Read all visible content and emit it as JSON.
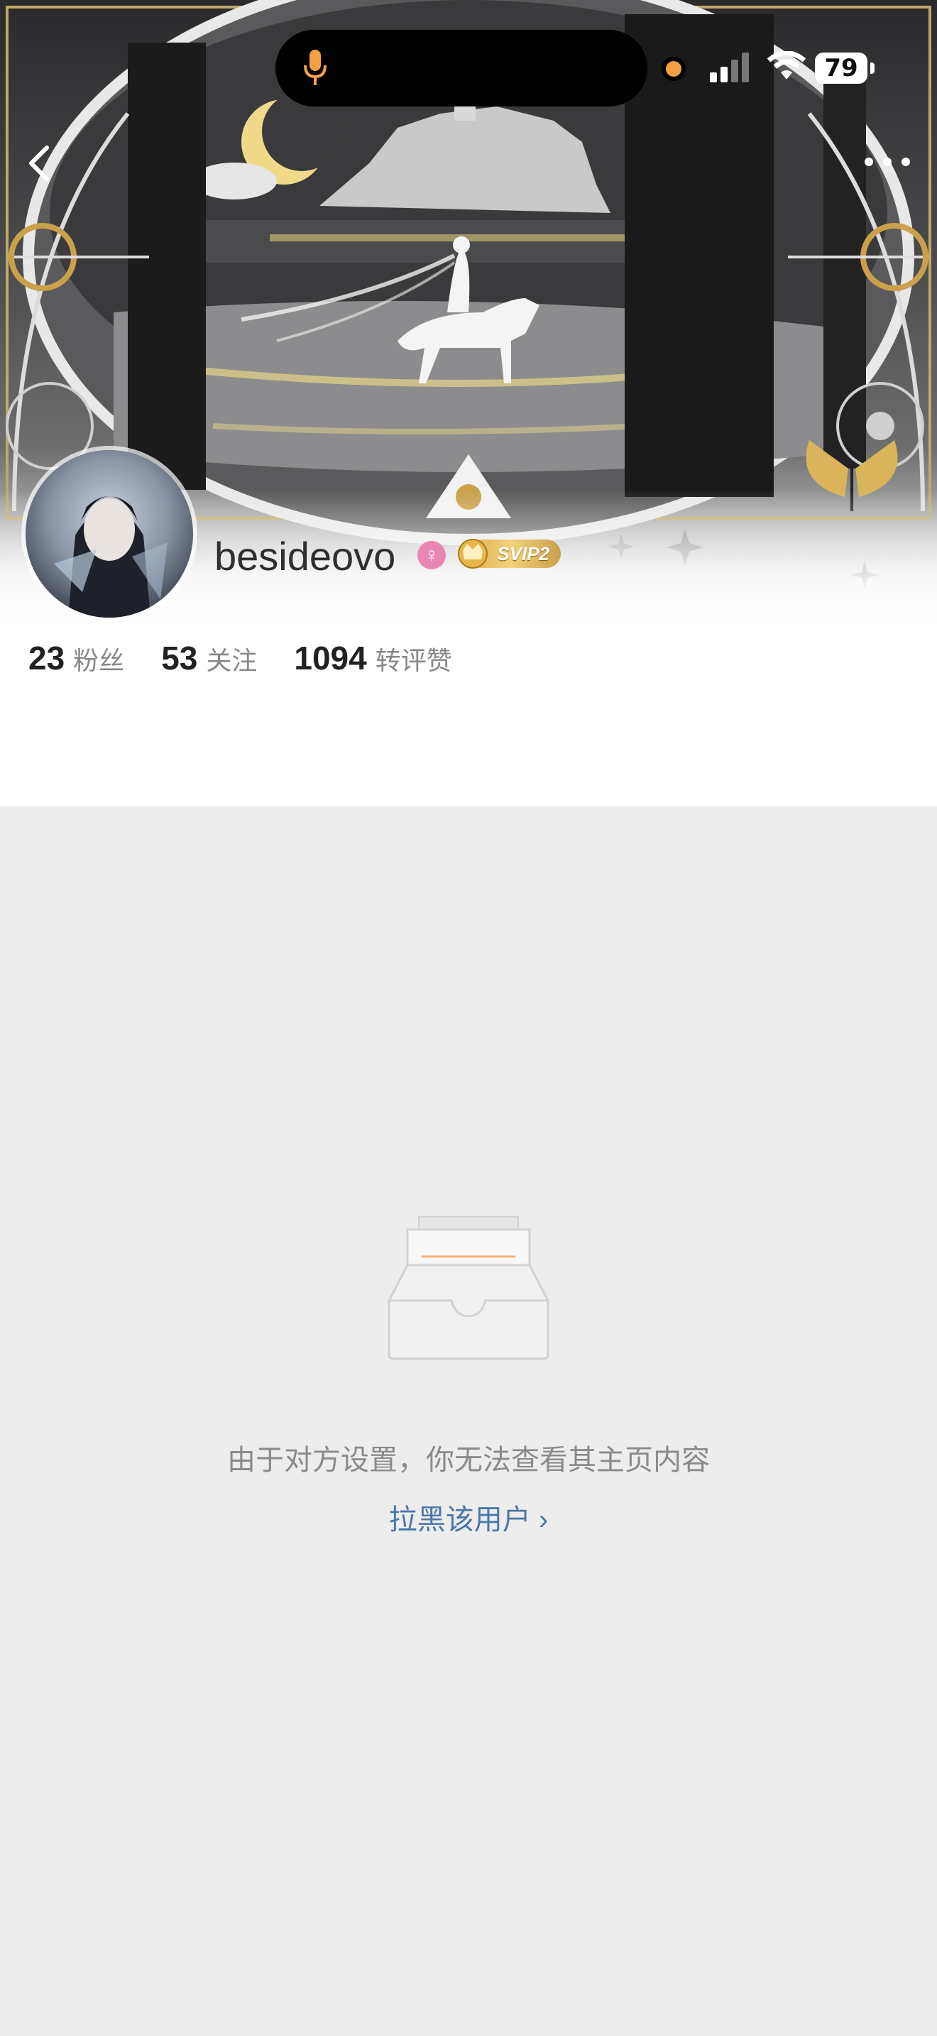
{
  "status_bar": {
    "battery": "79"
  },
  "profile": {
    "username": "besideovo",
    "gender_symbol": "♀",
    "vip_badge": "SVIP2"
  },
  "stats": [
    {
      "value": "23",
      "label": "粉丝"
    },
    {
      "value": "53",
      "label": "关注"
    },
    {
      "value": "1094",
      "label": "转评赞"
    }
  ],
  "empty_state": {
    "message": "由于对方设置，你无法查看其主页内容",
    "block_link": "拉黑该用户 ›"
  },
  "colors": {
    "link_blue": "#4c77aa",
    "orange_accent": "#f5a043",
    "page_bg": "#ededed"
  }
}
